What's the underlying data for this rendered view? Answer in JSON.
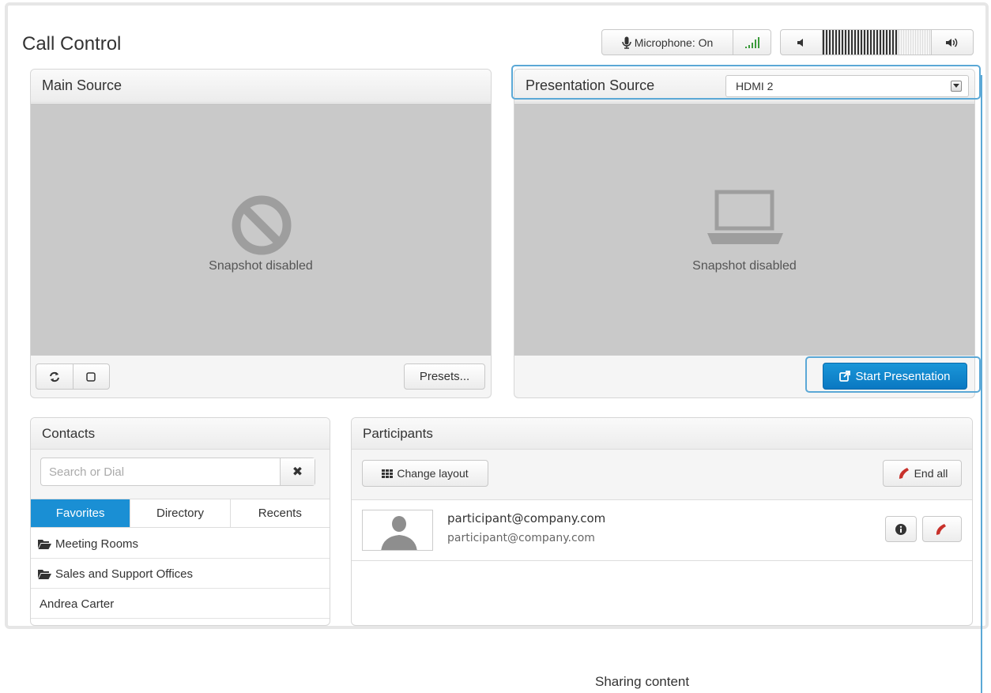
{
  "header": {
    "title": "Call Control",
    "microphone_label": "Microphone: On",
    "volume_level": 0.7
  },
  "main_source": {
    "title": "Main Source",
    "snapshot_text": "Snapshot disabled",
    "presets_label": "Presets..."
  },
  "presentation": {
    "title": "Presentation Source",
    "selected_source": "HDMI 2",
    "snapshot_text": "Snapshot disabled",
    "start_label": "Start Presentation"
  },
  "contacts": {
    "title": "Contacts",
    "search_placeholder": "Search or Dial",
    "tabs": [
      {
        "label": "Favorites"
      },
      {
        "label": "Directory"
      },
      {
        "label": "Recents"
      }
    ],
    "items": [
      {
        "label": "Meeting Rooms",
        "icon": "folder-icon"
      },
      {
        "label": "Sales and Support Offices",
        "icon": "folder-icon"
      },
      {
        "label": "Andrea Carter"
      }
    ]
  },
  "participants": {
    "title": "Participants",
    "change_layout_label": "Change layout",
    "end_all_label": "End all",
    "list": [
      {
        "name": "participant@company.com",
        "address": "participant@company.com"
      }
    ]
  },
  "annotation": {
    "label": "Sharing content"
  },
  "colors": {
    "accent": "#1a8fd4",
    "callout": "#5ba8d6",
    "hangup": "#c8312b"
  }
}
